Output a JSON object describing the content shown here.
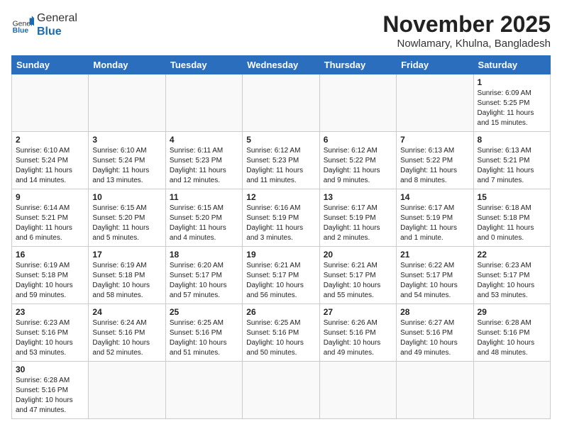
{
  "header": {
    "logo_general": "General",
    "logo_blue": "Blue",
    "month_year": "November 2025",
    "location": "Nowlamary, Khulna, Bangladesh"
  },
  "weekdays": [
    "Sunday",
    "Monday",
    "Tuesday",
    "Wednesday",
    "Thursday",
    "Friday",
    "Saturday"
  ],
  "weeks": [
    [
      {
        "day": "",
        "info": ""
      },
      {
        "day": "",
        "info": ""
      },
      {
        "day": "",
        "info": ""
      },
      {
        "day": "",
        "info": ""
      },
      {
        "day": "",
        "info": ""
      },
      {
        "day": "",
        "info": ""
      },
      {
        "day": "1",
        "info": "Sunrise: 6:09 AM\nSunset: 5:25 PM\nDaylight: 11 hours\nand 15 minutes."
      }
    ],
    [
      {
        "day": "2",
        "info": "Sunrise: 6:10 AM\nSunset: 5:24 PM\nDaylight: 11 hours\nand 14 minutes."
      },
      {
        "day": "3",
        "info": "Sunrise: 6:10 AM\nSunset: 5:24 PM\nDaylight: 11 hours\nand 13 minutes."
      },
      {
        "day": "4",
        "info": "Sunrise: 6:11 AM\nSunset: 5:23 PM\nDaylight: 11 hours\nand 12 minutes."
      },
      {
        "day": "5",
        "info": "Sunrise: 6:12 AM\nSunset: 5:23 PM\nDaylight: 11 hours\nand 11 minutes."
      },
      {
        "day": "6",
        "info": "Sunrise: 6:12 AM\nSunset: 5:22 PM\nDaylight: 11 hours\nand 9 minutes."
      },
      {
        "day": "7",
        "info": "Sunrise: 6:13 AM\nSunset: 5:22 PM\nDaylight: 11 hours\nand 8 minutes."
      },
      {
        "day": "8",
        "info": "Sunrise: 6:13 AM\nSunset: 5:21 PM\nDaylight: 11 hours\nand 7 minutes."
      }
    ],
    [
      {
        "day": "9",
        "info": "Sunrise: 6:14 AM\nSunset: 5:21 PM\nDaylight: 11 hours\nand 6 minutes."
      },
      {
        "day": "10",
        "info": "Sunrise: 6:15 AM\nSunset: 5:20 PM\nDaylight: 11 hours\nand 5 minutes."
      },
      {
        "day": "11",
        "info": "Sunrise: 6:15 AM\nSunset: 5:20 PM\nDaylight: 11 hours\nand 4 minutes."
      },
      {
        "day": "12",
        "info": "Sunrise: 6:16 AM\nSunset: 5:19 PM\nDaylight: 11 hours\nand 3 minutes."
      },
      {
        "day": "13",
        "info": "Sunrise: 6:17 AM\nSunset: 5:19 PM\nDaylight: 11 hours\nand 2 minutes."
      },
      {
        "day": "14",
        "info": "Sunrise: 6:17 AM\nSunset: 5:19 PM\nDaylight: 11 hours\nand 1 minute."
      },
      {
        "day": "15",
        "info": "Sunrise: 6:18 AM\nSunset: 5:18 PM\nDaylight: 11 hours\nand 0 minutes."
      }
    ],
    [
      {
        "day": "16",
        "info": "Sunrise: 6:19 AM\nSunset: 5:18 PM\nDaylight: 10 hours\nand 59 minutes."
      },
      {
        "day": "17",
        "info": "Sunrise: 6:19 AM\nSunset: 5:18 PM\nDaylight: 10 hours\nand 58 minutes."
      },
      {
        "day": "18",
        "info": "Sunrise: 6:20 AM\nSunset: 5:17 PM\nDaylight: 10 hours\nand 57 minutes."
      },
      {
        "day": "19",
        "info": "Sunrise: 6:21 AM\nSunset: 5:17 PM\nDaylight: 10 hours\nand 56 minutes."
      },
      {
        "day": "20",
        "info": "Sunrise: 6:21 AM\nSunset: 5:17 PM\nDaylight: 10 hours\nand 55 minutes."
      },
      {
        "day": "21",
        "info": "Sunrise: 6:22 AM\nSunset: 5:17 PM\nDaylight: 10 hours\nand 54 minutes."
      },
      {
        "day": "22",
        "info": "Sunrise: 6:23 AM\nSunset: 5:17 PM\nDaylight: 10 hours\nand 53 minutes."
      }
    ],
    [
      {
        "day": "23",
        "info": "Sunrise: 6:23 AM\nSunset: 5:16 PM\nDaylight: 10 hours\nand 53 minutes."
      },
      {
        "day": "24",
        "info": "Sunrise: 6:24 AM\nSunset: 5:16 PM\nDaylight: 10 hours\nand 52 minutes."
      },
      {
        "day": "25",
        "info": "Sunrise: 6:25 AM\nSunset: 5:16 PM\nDaylight: 10 hours\nand 51 minutes."
      },
      {
        "day": "26",
        "info": "Sunrise: 6:25 AM\nSunset: 5:16 PM\nDaylight: 10 hours\nand 50 minutes."
      },
      {
        "day": "27",
        "info": "Sunrise: 6:26 AM\nSunset: 5:16 PM\nDaylight: 10 hours\nand 49 minutes."
      },
      {
        "day": "28",
        "info": "Sunrise: 6:27 AM\nSunset: 5:16 PM\nDaylight: 10 hours\nand 49 minutes."
      },
      {
        "day": "29",
        "info": "Sunrise: 6:28 AM\nSunset: 5:16 PM\nDaylight: 10 hours\nand 48 minutes."
      }
    ],
    [
      {
        "day": "30",
        "info": "Sunrise: 6:28 AM\nSunset: 5:16 PM\nDaylight: 10 hours\nand 47 minutes."
      },
      {
        "day": "",
        "info": ""
      },
      {
        "day": "",
        "info": ""
      },
      {
        "day": "",
        "info": ""
      },
      {
        "day": "",
        "info": ""
      },
      {
        "day": "",
        "info": ""
      },
      {
        "day": "",
        "info": ""
      }
    ]
  ]
}
